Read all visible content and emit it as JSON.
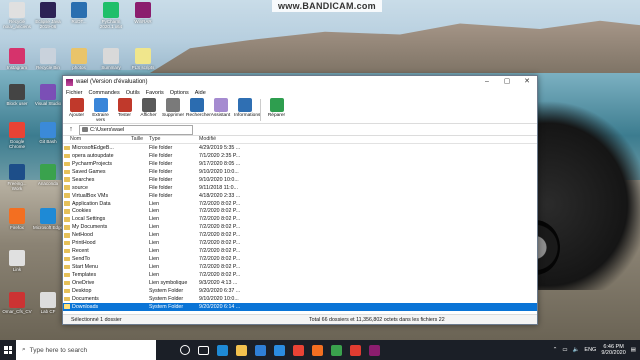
{
  "watermark": "www.BANDICAM.com",
  "desktop_icons": [
    {
      "label": "Recyclé nouv_anciens",
      "color": "#e0e0e0"
    },
    {
      "label": "Eclipse Java 2019-06",
      "color": "#2c2255"
    },
    {
      "label": "RoDT...",
      "color": "#2a6fb0"
    },
    {
      "label": "PyCharm 2020.1 x64",
      "color": "#1fbf6a"
    },
    {
      "label": "WinRAR",
      "color": "#8b1d6e"
    },
    {
      "label": "Instagram",
      "color": "#d6336c"
    },
    {
      "label": "Recycle Bin",
      "color": "#c9d2dc"
    },
    {
      "label": "photos",
      "color": "#e9c46a"
    },
    {
      "label": "Summary",
      "color": "#d9d9d9"
    },
    {
      "label": "PLS scripts",
      "color": "#f0e68c"
    },
    {
      "label": "Block user",
      "color": "#444444"
    },
    {
      "label": "Visual Studio",
      "color": "#7b4fb6"
    },
    {
      "label": "Google Chrome",
      "color": "#e94335"
    },
    {
      "label": "Git Bash",
      "color": "#3b8ad8"
    },
    {
      "label": "Freeing... Work",
      "color": "#1d4e89"
    },
    {
      "label": "Anaconda",
      "color": "#3aa24d"
    },
    {
      "label": "Firefox",
      "color": "#f36f21"
    },
    {
      "label": "Microsoft Edge",
      "color": "#1e8ad6"
    },
    {
      "label": "Link",
      "color": "#e0e0e0"
    },
    {
      "label": "Omar_Cfs_CV",
      "color": "#cc3333"
    },
    {
      "label": "Lab CF",
      "color": "#dddddd"
    }
  ],
  "window": {
    "title": "wael (Version d'évaluation)",
    "menu": [
      "Fichier",
      "Commandes",
      "Outils",
      "Favoris",
      "Options",
      "Aide"
    ],
    "toolbar": [
      {
        "label": "Ajouter",
        "color": "#c0392b"
      },
      {
        "label": "Extraire vers",
        "color": "#3a86d9"
      },
      {
        "label": "Tester",
        "color": "#c0392b"
      },
      {
        "label": "Afficher",
        "color": "#5a5a5a"
      },
      {
        "label": "Supprimer",
        "color": "#7a7a7a"
      },
      {
        "label": "Rechercher",
        "color": "#2b6cb0"
      },
      {
        "label": "Assistant",
        "color": "#a58bd0"
      },
      {
        "label": "Informations",
        "color": "#2f6fb3"
      },
      {
        "label": "Réparer",
        "color": "#2e9e4f"
      }
    ],
    "address": "C:\\Users\\wael",
    "columns": {
      "name": "Nom",
      "size": "Taille",
      "type": "Type",
      "modified": "Modifié"
    },
    "rows": [
      {
        "name": "MicrosoftEdgeB...",
        "type": "File folder",
        "modified": "4/29/2019 5:35 ..."
      },
      {
        "name": "opera autoupdate",
        "type": "File folder",
        "modified": "7/1/2020 2:35 P..."
      },
      {
        "name": "PycharmProjects",
        "type": "File folder",
        "modified": "9/17/2020 8:05 ..."
      },
      {
        "name": "Saved Games",
        "type": "File folder",
        "modified": "9/10/2020 10:0..."
      },
      {
        "name": "Searches",
        "type": "File folder",
        "modified": "9/10/2020 10:0..."
      },
      {
        "name": "source",
        "type": "File folder",
        "modified": "9/11/2018 11:0..."
      },
      {
        "name": "VirtualBox VMs",
        "type": "File folder",
        "modified": "4/18/2020 2:33 ..."
      },
      {
        "name": "Application Data",
        "type": "Lien",
        "modified": "7/2/2020 8:02 P..."
      },
      {
        "name": "Cookies",
        "type": "Lien",
        "modified": "7/2/2020 8:02 P..."
      },
      {
        "name": "Local Settings",
        "type": "Lien",
        "modified": "7/2/2020 8:02 P..."
      },
      {
        "name": "My Documents",
        "type": "Lien",
        "modified": "7/2/2020 8:02 P..."
      },
      {
        "name": "NetHood",
        "type": "Lien",
        "modified": "7/2/2020 8:02 P..."
      },
      {
        "name": "PrintHood",
        "type": "Lien",
        "modified": "7/2/2020 8:02 P..."
      },
      {
        "name": "Recent",
        "type": "Lien",
        "modified": "7/2/2020 8:02 P..."
      },
      {
        "name": "SendTo",
        "type": "Lien",
        "modified": "7/2/2020 8:02 P..."
      },
      {
        "name": "Start Menu",
        "type": "Lien",
        "modified": "7/2/2020 8:02 P..."
      },
      {
        "name": "Templates",
        "type": "Lien",
        "modified": "7/2/2020 8:02 P..."
      },
      {
        "name": "OneDrive",
        "type": "Lien symbolique",
        "modified": "9/3/2020 4:13 ..."
      },
      {
        "name": "Desktop",
        "type": "System Folder",
        "modified": "9/20/2020 6:37 ..."
      },
      {
        "name": "Documents",
        "type": "System Folder",
        "modified": "9/10/2020 10:0..."
      },
      {
        "name": "Downloads",
        "type": "System Folder",
        "modified": "9/20/2020 6:14 ...",
        "selected": true
      }
    ],
    "status_left": "Sélectionné 1 dossier",
    "status_right": "Total 66 dossiers et 11,356,802 octets dans les fichiers 22"
  },
  "taskbar": {
    "search_placeholder": "Type here to search",
    "apps": [
      {
        "name": "cortana-icon",
        "color": "#ffffff"
      },
      {
        "name": "taskview-icon",
        "color": "#ffffff"
      },
      {
        "name": "edge-icon",
        "color": "#1e8ad6"
      },
      {
        "name": "explorer-icon",
        "color": "#f2c14e"
      },
      {
        "name": "mail-icon",
        "color": "#2f7fd6"
      },
      {
        "name": "vscode-icon",
        "color": "#2b8ce0"
      },
      {
        "name": "chrome-icon",
        "color": "#e94335"
      },
      {
        "name": "firefox-icon",
        "color": "#f36f21"
      },
      {
        "name": "store-icon",
        "color": "#3aa24d"
      },
      {
        "name": "record-icon",
        "color": "#e03c31"
      },
      {
        "name": "winrar-icon",
        "color": "#8b1d6e"
      }
    ],
    "language": "ENG",
    "time": "6:46 PM",
    "date": "9/20/2020"
  }
}
